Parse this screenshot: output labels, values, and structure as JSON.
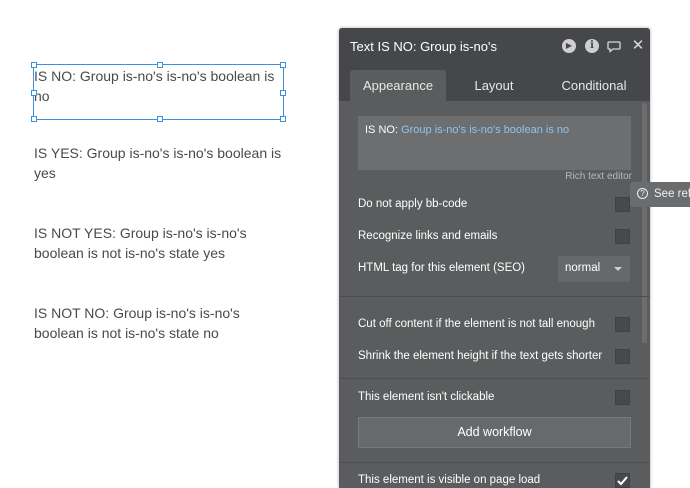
{
  "canvas": {
    "texts": [
      "IS NO: Group is-no's is-no's boolean is no",
      "IS YES: Group is-no's is-no's boolean is yes",
      "IS NOT YES: Group is-no's is-no's boolean is not is-no's state yes",
      "IS NOT NO: Group is-no's is-no's boolean is not is-no's state no"
    ]
  },
  "panel": {
    "title": "Text IS NO: Group is-no's",
    "tabs": [
      "Appearance",
      "Layout",
      "Conditional"
    ],
    "rte_prefix": "IS NO: ",
    "rte_dynamic": "Group is-no's is-no's boolean is no",
    "rte_label": "Rich text editor",
    "options": {
      "bbcode": "Do not apply bb-code",
      "links": "Recognize links and emails",
      "html_tag": "HTML tag for this element (SEO)",
      "html_tag_value": "normal",
      "cut_off": "Cut off content if the element is not tall enough",
      "shrink": "Shrink the element height if the text gets shorter",
      "not_clickable": "This element isn't clickable",
      "visible": "This element is visible on page load"
    },
    "add_workflow": "Add workflow"
  },
  "see_ref": "See ref",
  "icons": {
    "play": "play-icon",
    "info": "info-icon",
    "comment": "comment-icon",
    "close": "close-icon",
    "help": "question-icon"
  },
  "colors": {
    "panel_bg": "#5a5c5d",
    "header_bg": "#45474a",
    "dynamic_text": "#8fc4ee",
    "selection": "#3d8fe0"
  }
}
